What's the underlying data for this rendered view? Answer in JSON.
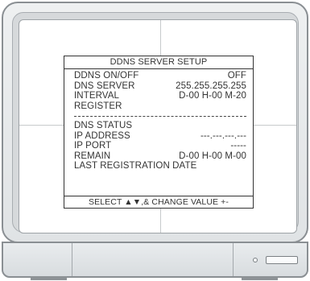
{
  "menu": {
    "title": "DDNS SERVER SETUP",
    "settings": [
      {
        "label": "DDNS ON/OFF",
        "value": "OFF"
      },
      {
        "label": "DNS SERVER",
        "value": "255.255.255.255"
      },
      {
        "label": "INTERVAL",
        "value": "D-00 H-00 M-20"
      },
      {
        "label": "REGISTER",
        "value": ""
      }
    ],
    "status": [
      {
        "label": "DNS STATUS",
        "value": ""
      },
      {
        "label": "IP ADDRESS",
        "value": "---.---.---.---"
      },
      {
        "label": "IP PORT",
        "value": "-----"
      },
      {
        "label": "REMAIN",
        "value": "D-00 H-00 M-00"
      },
      {
        "label": "LAST REGISTRATION DATE",
        "value": ""
      }
    ],
    "footer": "SELECT ▲▼,& CHANGE VALUE +-"
  }
}
